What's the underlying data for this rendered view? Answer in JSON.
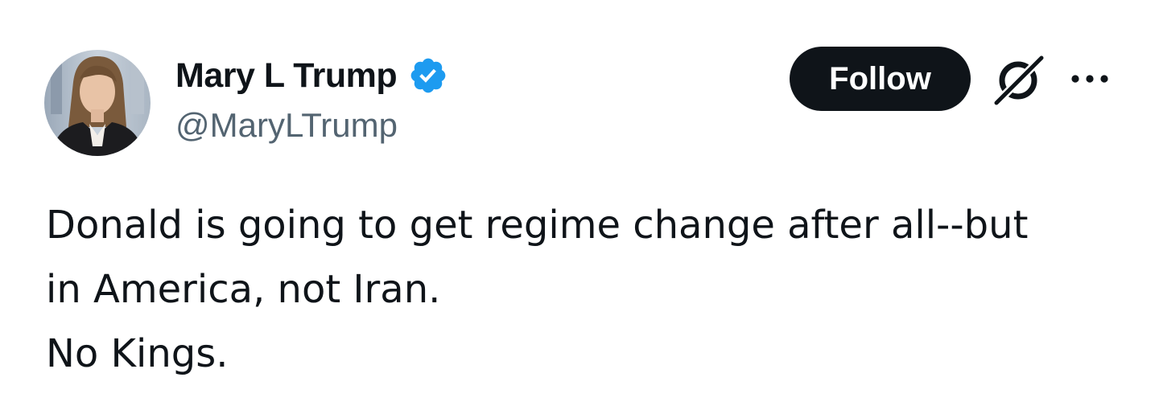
{
  "author": {
    "display_name": "Mary L Trump",
    "handle": "@MaryLTrump",
    "verified": true,
    "verified_color": "#1d9bf0"
  },
  "actions": {
    "follow_label": "Follow",
    "grok_icon": "grok-icon",
    "more_icon": "more-options-icon"
  },
  "tweet": {
    "lines": [
      "Donald is going to get regime change after all--but",
      "in America, not Iran.",
      "No Kings."
    ]
  },
  "colors": {
    "text": "#0f1419",
    "secondary": "#536471",
    "button_bg": "#0f1419",
    "button_text": "#ffffff"
  }
}
